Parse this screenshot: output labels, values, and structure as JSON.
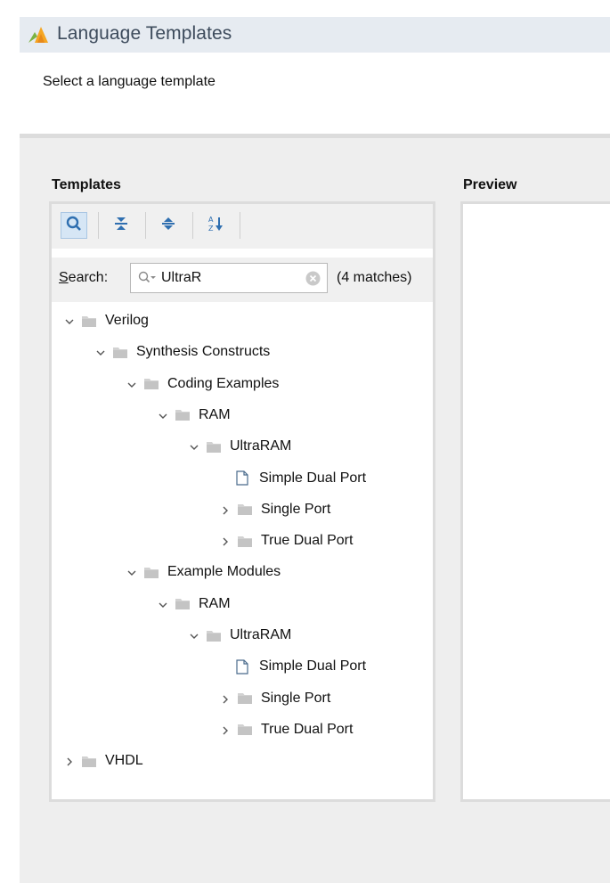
{
  "window": {
    "title": "Language Templates",
    "subtitle": "Select a language template"
  },
  "templates": {
    "label": "Templates",
    "toolbar": {
      "icons": [
        "search-icon",
        "collapse-all-icon",
        "expand-all-icon",
        "sort-icon"
      ]
    },
    "search": {
      "label_prefix": "S",
      "label_rest": "earch:",
      "value": "UltraR",
      "matches": "(4 matches)"
    },
    "tree": [
      {
        "label": "Verilog",
        "type": "folder",
        "expanded": true
      },
      {
        "label": "Synthesis Constructs",
        "type": "folder",
        "expanded": true
      },
      {
        "label": "Coding Examples",
        "type": "folder",
        "expanded": true
      },
      {
        "label": "RAM",
        "type": "folder",
        "expanded": true
      },
      {
        "label": "UltraRAM",
        "type": "folder",
        "expanded": true
      },
      {
        "label": "Simple Dual Port",
        "type": "file"
      },
      {
        "label": "Single Port",
        "type": "folder",
        "expanded": false
      },
      {
        "label": "True Dual Port",
        "type": "folder",
        "expanded": false
      },
      {
        "label": "Example Modules",
        "type": "folder",
        "expanded": true
      },
      {
        "label": "RAM",
        "type": "folder",
        "expanded": true
      },
      {
        "label": "UltraRAM",
        "type": "folder",
        "expanded": true
      },
      {
        "label": "Simple Dual Port",
        "type": "file"
      },
      {
        "label": "Single Port",
        "type": "folder",
        "expanded": false
      },
      {
        "label": "True Dual Port",
        "type": "folder",
        "expanded": false
      },
      {
        "label": "VHDL",
        "type": "folder",
        "expanded": false
      }
    ]
  },
  "preview": {
    "label": "Preview"
  },
  "colors": {
    "titlebar": "#e6ebf1",
    "title_text": "#3d4b5c",
    "folder_icon": "#c8c8c8",
    "accent": "#2f6fb0"
  }
}
